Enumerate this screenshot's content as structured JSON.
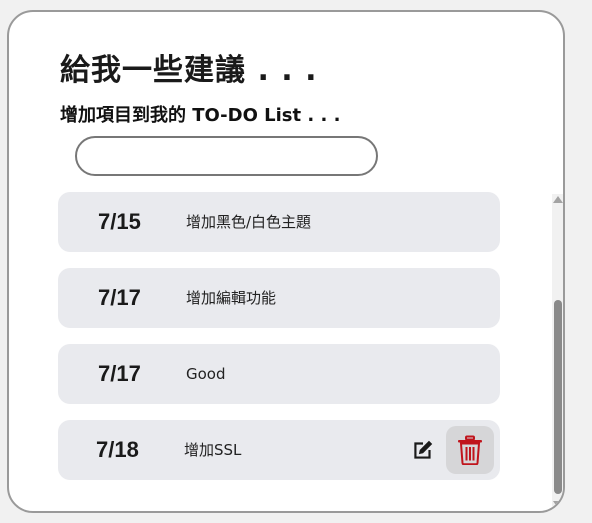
{
  "header": {
    "title": "給我一些建議 . . .",
    "subtitle": "增加項目到我的 TO-DO List . . ."
  },
  "input": {
    "value": "",
    "placeholder": ""
  },
  "todo_items": [
    {
      "date": "7/15",
      "text": "增加黑色/白色主題"
    },
    {
      "date": "7/17",
      "text": "增加編輯功能"
    },
    {
      "date": "7/17",
      "text": "Good"
    },
    {
      "date": "7/18",
      "text": "增加SSL"
    }
  ],
  "icons": {
    "edit": "edit-icon",
    "delete": "trash-icon"
  },
  "colors": {
    "item_background": "#e9eaee",
    "delete_icon": "#c0141c",
    "delete_button_bg": "#d6d6d8",
    "scroll_thumb": "#8a8a8a"
  }
}
